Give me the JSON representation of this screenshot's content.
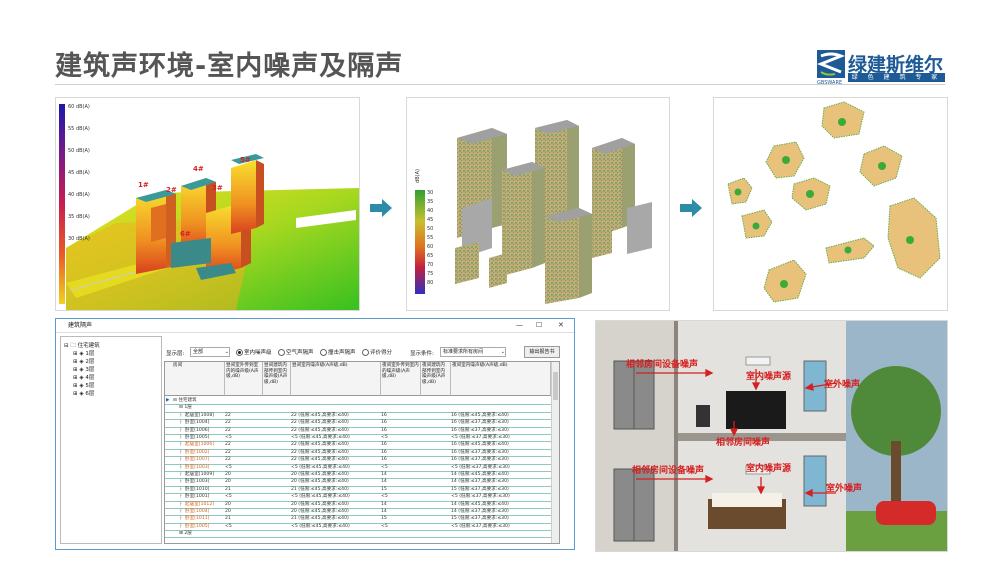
{
  "slide": {
    "title": "建筑声环境-室内噪声及隔声"
  },
  "logo": {
    "name_cn": "绿建斯维尔",
    "tagline": "绿 色 建 筑 专 家",
    "name_en": "GBSWARE"
  },
  "panel1": {
    "legend": [
      "60 dB(A)",
      "55 dB(A)",
      "50 dB(A)",
      "45 dB(A)",
      "40 dB(A)",
      "35 dB(A)",
      "30 dB(A)"
    ],
    "building_labels": [
      "5#",
      "4#",
      "1#",
      "2#",
      "3#",
      "6#"
    ]
  },
  "panel2": {
    "legend_title": "dB(A)",
    "legend_values": [
      "30",
      "35",
      "40",
      "45",
      "50",
      "55",
      "60",
      "65",
      "70",
      "75",
      "80"
    ]
  },
  "window": {
    "title": "建筑隔声",
    "controls": [
      "—",
      "☐",
      "✕"
    ],
    "tree": {
      "root": "住宅建筑",
      "floors": [
        "1层",
        "2层",
        "3层",
        "4层",
        "5层",
        "6层"
      ]
    },
    "toolbar": {
      "display_label": "显示层:",
      "display_value": "全部",
      "radios": [
        "室内噪声级",
        "空气声隔声",
        "撞击声隔声",
        "评价得分"
      ],
      "condition_label": "显示条件:",
      "condition_value": "标准要求所有房间",
      "export_button": "输出报告书"
    },
    "columns": [
      "房间",
      "昼间室外传到室内的噪声级(A声级,dB)",
      "昼间建筑内部传到室内噪声级(A声级,dB)",
      "昼间室内噪声级(A声级,dB)",
      "夜间室外传到室内的噪声级(A声级,dB)",
      "夜间建筑内部传到室内噪声级(A声级,dB)",
      "夜间室内噪声级(A声级,dB)"
    ],
    "group_rows": [
      "住宅建筑",
      "1层"
    ],
    "rows": [
      {
        "room": "起居室[1008]",
        "d1": "22",
        "d2": "",
        "d3": "22 (低限:≤45,高要求:≤40)",
        "n1": "16",
        "n2": "",
        "n3": "16 (低限:≤45,高要求:≤40)",
        "hl": false
      },
      {
        "room": "卧室[1004]",
        "d1": "22",
        "d2": "",
        "d3": "22 (低限:≤45,高要求:≤40)",
        "n1": "16",
        "n2": "",
        "n3": "16 (低限:≤37,高要求:≤30)",
        "hl": false
      },
      {
        "room": "卧室[1006]",
        "d1": "22",
        "d2": "",
        "d3": "22 (低限:≤45,高要求:≤40)",
        "n1": "16",
        "n2": "",
        "n3": "16 (低限:≤37,高要求:≤30)",
        "hl": false
      },
      {
        "room": "卧室[1005]",
        "d1": "<5",
        "d2": "",
        "d3": "<5 (低限:≤45,高要求:≤40)",
        "n1": "<5",
        "n2": "",
        "n3": "<5 (低限:≤37,高要求:≤30)",
        "hl": false
      },
      {
        "room": "起居室[1006]",
        "d1": "22",
        "d2": "",
        "d3": "22 (低限:≤45,高要求:≤40)",
        "n1": "16",
        "n2": "",
        "n3": "16 (低限:≤45,高要求:≤40)",
        "hl": true
      },
      {
        "room": "卧室[1002]",
        "d1": "22",
        "d2": "",
        "d3": "22 (低限:≤45,高要求:≤40)",
        "n1": "16",
        "n2": "",
        "n3": "16 (低限:≤37,高要求:≤30)",
        "hl": true
      },
      {
        "room": "卧室[1007]",
        "d1": "22",
        "d2": "",
        "d3": "22 (低限:≤45,高要求:≤40)",
        "n1": "16",
        "n2": "",
        "n3": "16 (低限:≤37,高要求:≤30)",
        "hl": true
      },
      {
        "room": "卧室[1003]",
        "d1": "<5",
        "d2": "",
        "d3": "<5 (低限:≤45,高要求:≤40)",
        "n1": "<5",
        "n2": "",
        "n3": "<5 (低限:≤37,高要求:≤30)",
        "hl": true
      },
      {
        "room": "起居室[1009]",
        "d1": "20",
        "d2": "",
        "d3": "20 (低限:≤45,高要求:≤40)",
        "n1": "14",
        "n2": "",
        "n3": "14 (低限:≤45,高要求:≤40)",
        "hl": false
      },
      {
        "room": "卧室[1003]",
        "d1": "20",
        "d2": "",
        "d3": "20 (低限:≤45,高要求:≤40)",
        "n1": "14",
        "n2": "",
        "n3": "14 (低限:≤37,高要求:≤30)",
        "hl": false
      },
      {
        "room": "卧室[1010]",
        "d1": "21",
        "d2": "",
        "d3": "21 (低限:≤45,高要求:≤40)",
        "n1": "15",
        "n2": "",
        "n3": "15 (低限:≤37,高要求:≤30)",
        "hl": false
      },
      {
        "room": "卧室[1001]",
        "d1": "<5",
        "d2": "",
        "d3": "<5 (低限:≤45,高要求:≤40)",
        "n1": "<5",
        "n2": "",
        "n3": "<5 (低限:≤37,高要求:≤30)",
        "hl": false
      },
      {
        "room": "起居室[1012]",
        "d1": "20",
        "d2": "",
        "d3": "20 (低限:≤45,高要求:≤40)",
        "n1": "14",
        "n2": "",
        "n3": "14 (低限:≤45,高要求:≤40)",
        "hl": true
      },
      {
        "room": "卧室[1004]",
        "d1": "20",
        "d2": "",
        "d3": "20 (低限:≤45,高要求:≤40)",
        "n1": "14",
        "n2": "",
        "n3": "14 (低限:≤37,高要求:≤30)",
        "hl": true
      },
      {
        "room": "卧室[1011]",
        "d1": "21",
        "d2": "",
        "d3": "21 (低限:≤45,高要求:≤40)",
        "n1": "15",
        "n2": "",
        "n3": "15 (低限:≤37,高要求:≤30)",
        "hl": true
      },
      {
        "room": "卧室[1005]",
        "d1": "<5",
        "d2": "",
        "d3": "<5 (低限:≤45,高要求:≤40)",
        "n1": "<5",
        "n2": "",
        "n3": "<5 (低限:≤37,高要求:≤30)",
        "hl": true
      }
    ],
    "tail_row": "2层"
  },
  "panel4": {
    "labels": [
      "相邻房间设备噪声",
      "室内噪声源",
      "室外噪声",
      "相邻房间噪声",
      "相邻房间设备噪声",
      "室内噪声源",
      "室外噪声"
    ]
  },
  "colors": {
    "accent": "#1d5a96",
    "arrow": "#2e8ba8",
    "annotation_red": "#d42020"
  }
}
